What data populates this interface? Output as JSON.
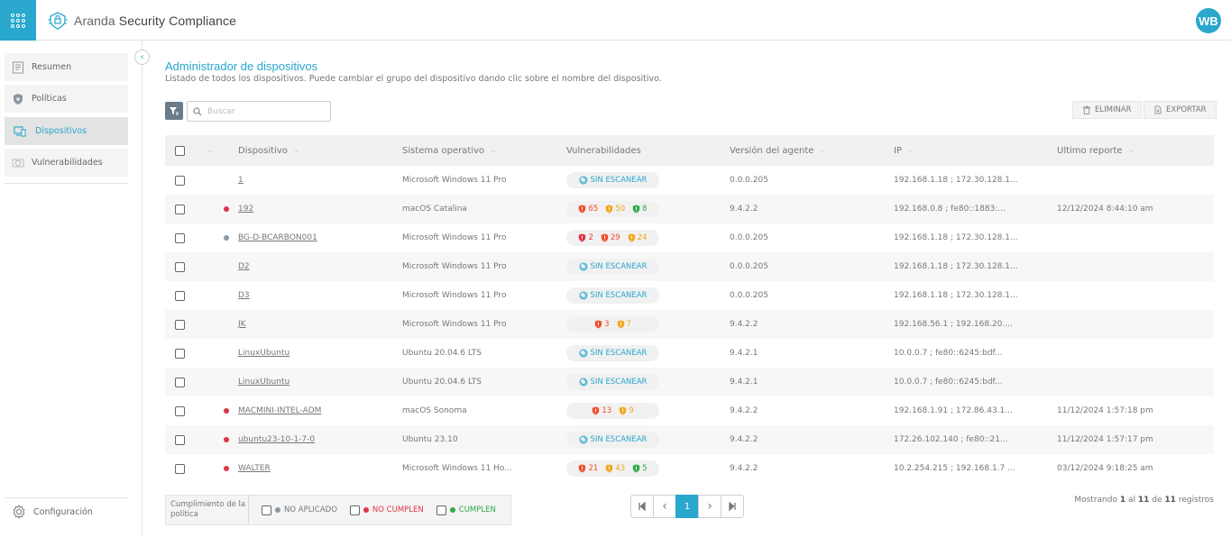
{
  "app": {
    "brand_light": "Aranda",
    "brand_bold": "Security Compliance",
    "user_initials": "WB",
    "accent_color": "#29a7cd"
  },
  "sidebar": {
    "items": [
      {
        "label": "Resumen",
        "icon": "report-icon",
        "active": false
      },
      {
        "label": "Políticas",
        "icon": "shield-star-icon",
        "active": false
      },
      {
        "label": "Dispositivos",
        "icon": "devices-icon",
        "active": true
      },
      {
        "label": "Vulnerabilidades",
        "icon": "bug-shield-icon",
        "active": false
      }
    ],
    "config_label": "Configuración"
  },
  "page": {
    "title": "Administrador de dispositivos",
    "subtitle": "Listado de todos los dispositivos. Puede cambiar el grupo del dispositivo dando clic sobre el nombre del dispositivo.",
    "search_placeholder": "Buscar",
    "delete_label": "ELIMINAR",
    "export_label": "EXPORTAR"
  },
  "table": {
    "headers": {
      "device": "Dispositivo",
      "os": "Sistema operativo",
      "vulns": "Vulnerabilidades",
      "agent": "Versión del agente",
      "ip": "IP",
      "report": "Ultimo reporte"
    },
    "scan_label": "SIN ESCANEAR",
    "rows": [
      {
        "status": "",
        "name": "1",
        "os": "Microsoft Windows 11 Pro",
        "scan": true,
        "v": [],
        "agent": "0.0.0.205",
        "ip": "192.168.1.18 ; 172.30.128.1...",
        "report": ""
      },
      {
        "status": "red",
        "name": "192",
        "os": "macOS Catalina",
        "scan": false,
        "v": [
          [
            "red",
            "65"
          ],
          [
            "orange",
            "50"
          ],
          [
            "green",
            "8"
          ]
        ],
        "agent": "9.4.2.2",
        "ip": "192.168.0.8 ; fe80::1883:...",
        "report": "12/12/2024 8:44:10 am"
      },
      {
        "status": "grey",
        "name": "BG-D-BCARBON001",
        "os": "Microsoft Windows 11 Pro",
        "scan": false,
        "v": [
          [
            "crimson",
            "2"
          ],
          [
            "red",
            "29"
          ],
          [
            "orange",
            "24"
          ]
        ],
        "agent": "0.0.0.205",
        "ip": "192.168.1.18 ; 172.30.128.1...",
        "report": ""
      },
      {
        "status": "",
        "name": "D2",
        "os": "Microsoft Windows 11 Pro",
        "scan": true,
        "v": [],
        "agent": "0.0.0.205",
        "ip": "192.168.1.18 ; 172.30.128.1...",
        "report": ""
      },
      {
        "status": "",
        "name": "D3",
        "os": "Microsoft Windows 11 Pro",
        "scan": true,
        "v": [],
        "agent": "0.0.0.205",
        "ip": "192.168.1.18 ; 172.30.128.1...",
        "report": ""
      },
      {
        "status": "",
        "name": "JK",
        "os": "Microsoft Windows 11 Pro",
        "scan": false,
        "v": [
          [
            "red",
            "3"
          ],
          [
            "orange",
            "7"
          ]
        ],
        "agent": "9.4.2.2",
        "ip": "192.168.56.1 ; 192.168.20....",
        "report": ""
      },
      {
        "status": "",
        "name": "LinuxUbuntu",
        "os": "Ubuntu 20.04.6 LTS",
        "scan": true,
        "v": [],
        "agent": "9.4.2.1",
        "ip": "10.0.0.7 ; fe80::6245:bdf...",
        "report": ""
      },
      {
        "status": "",
        "name": "LinuxUbuntu",
        "os": "Ubuntu 20.04.6 LTS",
        "scan": true,
        "v": [],
        "agent": "9.4.2.1",
        "ip": "10.0.0.7 ; fe80::6245:bdf...",
        "report": ""
      },
      {
        "status": "red",
        "name": "MACMINI-INTEL-ADM",
        "os": "macOS Sonoma",
        "scan": false,
        "v": [
          [
            "red",
            "13"
          ],
          [
            "orange",
            "9"
          ]
        ],
        "agent": "9.4.2.2",
        "ip": "192.168.1.91 ; 172.86.43.1...",
        "report": "11/12/2024 1:57:18 pm"
      },
      {
        "status": "red",
        "name": "ubuntu23-10-1-7-0",
        "os": "Ubuntu 23.10",
        "scan": true,
        "v": [],
        "agent": "9.4.2.2",
        "ip": "172.26.102.140 ; fe80::21...",
        "report": "11/12/2024 1:57:17 pm"
      },
      {
        "status": "red",
        "name": "WALTER",
        "os": "Microsoft Windows 11 Ho...",
        "scan": false,
        "v": [
          [
            "red",
            "21"
          ],
          [
            "orange",
            "43"
          ],
          [
            "green",
            "5"
          ]
        ],
        "agent": "9.4.2.2",
        "ip": "10.2.254.215 ; 192.168.1.7 ...",
        "report": "03/12/2024 9:18:25 am"
      }
    ]
  },
  "legend": {
    "label": "Cumplimiento de la política",
    "options": [
      {
        "label": "NO APLICADO",
        "color": "#8a96a3"
      },
      {
        "label": "NO CUMPLEN",
        "color": "#e0344a"
      },
      {
        "label": "CUMPLEN",
        "color": "#2eaa4a"
      }
    ]
  },
  "pagination": {
    "current_page": "1",
    "showing_prefix": "Mostrando",
    "from": "1",
    "to_word": "al",
    "to": "11",
    "of_word": "de",
    "total": "11",
    "suffix": "registros"
  },
  "colors": {
    "red": "#f04e2a",
    "orange": "#f2a51c",
    "green": "#2eaa4a",
    "crimson": "#e0344a",
    "grey": "#8a96a3"
  }
}
